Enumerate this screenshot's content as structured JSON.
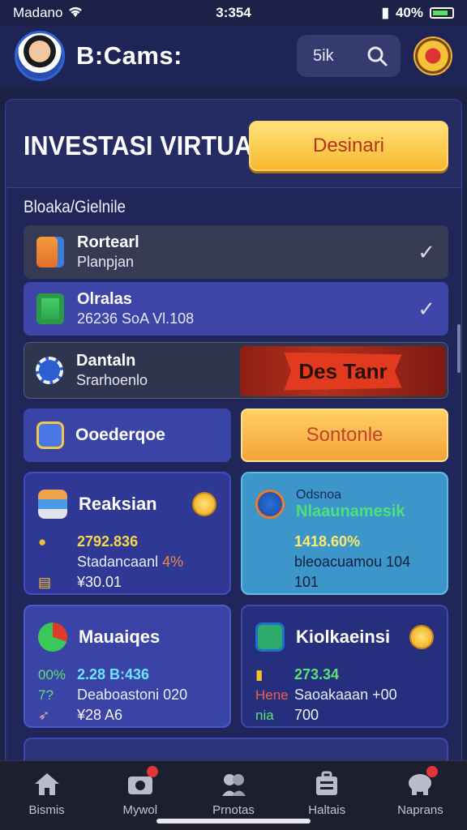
{
  "status_bar": {
    "carrier": "Madano",
    "time": "3:354",
    "battery": "40%"
  },
  "header": {
    "brand": "B:Cams:",
    "search_label": "5ik"
  },
  "hero": {
    "title": "INVESTASI VIRTUAL",
    "button": "Desinari"
  },
  "section": {
    "label": "Bloaka/Gielnile"
  },
  "rows": [
    {
      "title": "Rortearl",
      "subtitle": "Planpjan"
    },
    {
      "title": "Olralas",
      "subtitle": "26236 SoA Vl.108"
    }
  ],
  "split_row": {
    "title": "Dantaln",
    "subtitle": "Srarhoenlo",
    "banner": "Des Tanr"
  },
  "pair": {
    "left_label": "Ooederqoe",
    "right_label": "Sontonle"
  },
  "cards": [
    {
      "title": "Reaksian",
      "value": "2792.836",
      "line2_text": "Stadancaanl ",
      "line2_highlight": "4%",
      "line3": "¥30.01"
    },
    {
      "subtitle": "Odsnoa",
      "title": "Nlaaunamesik",
      "value": "1418.60%",
      "line2_text": "bleoacuamou ",
      "line2_highlight": "104",
      "line3": "101"
    },
    {
      "title": "Mauaiqes",
      "tag1": "00%",
      "tag2": "7?",
      "value": "2.28 B:436",
      "line2_text": "Deaboastoni ",
      "line2_highlight": "020",
      "line3": "¥28 A6"
    },
    {
      "title": "Kiolkaeinsi",
      "tag1": "",
      "tag2": "Hene",
      "tag3": "nia",
      "value": "273.34",
      "line2_text": "Saoakaaan ",
      "line2_highlight": "+00",
      "line3": "700"
    }
  ],
  "tabs": [
    {
      "label": "Bismis",
      "icon": "home-icon"
    },
    {
      "label": "Mywol",
      "icon": "camera-icon"
    },
    {
      "label": "Prnotas",
      "icon": "people-icon"
    },
    {
      "label": "Haltais",
      "icon": "briefcase-icon"
    },
    {
      "label": "Naprans",
      "icon": "elephant-icon"
    }
  ],
  "colors": {
    "accent_yellow": "#f8b82d",
    "accent_red": "#b3301c",
    "panel": "#252c63"
  }
}
